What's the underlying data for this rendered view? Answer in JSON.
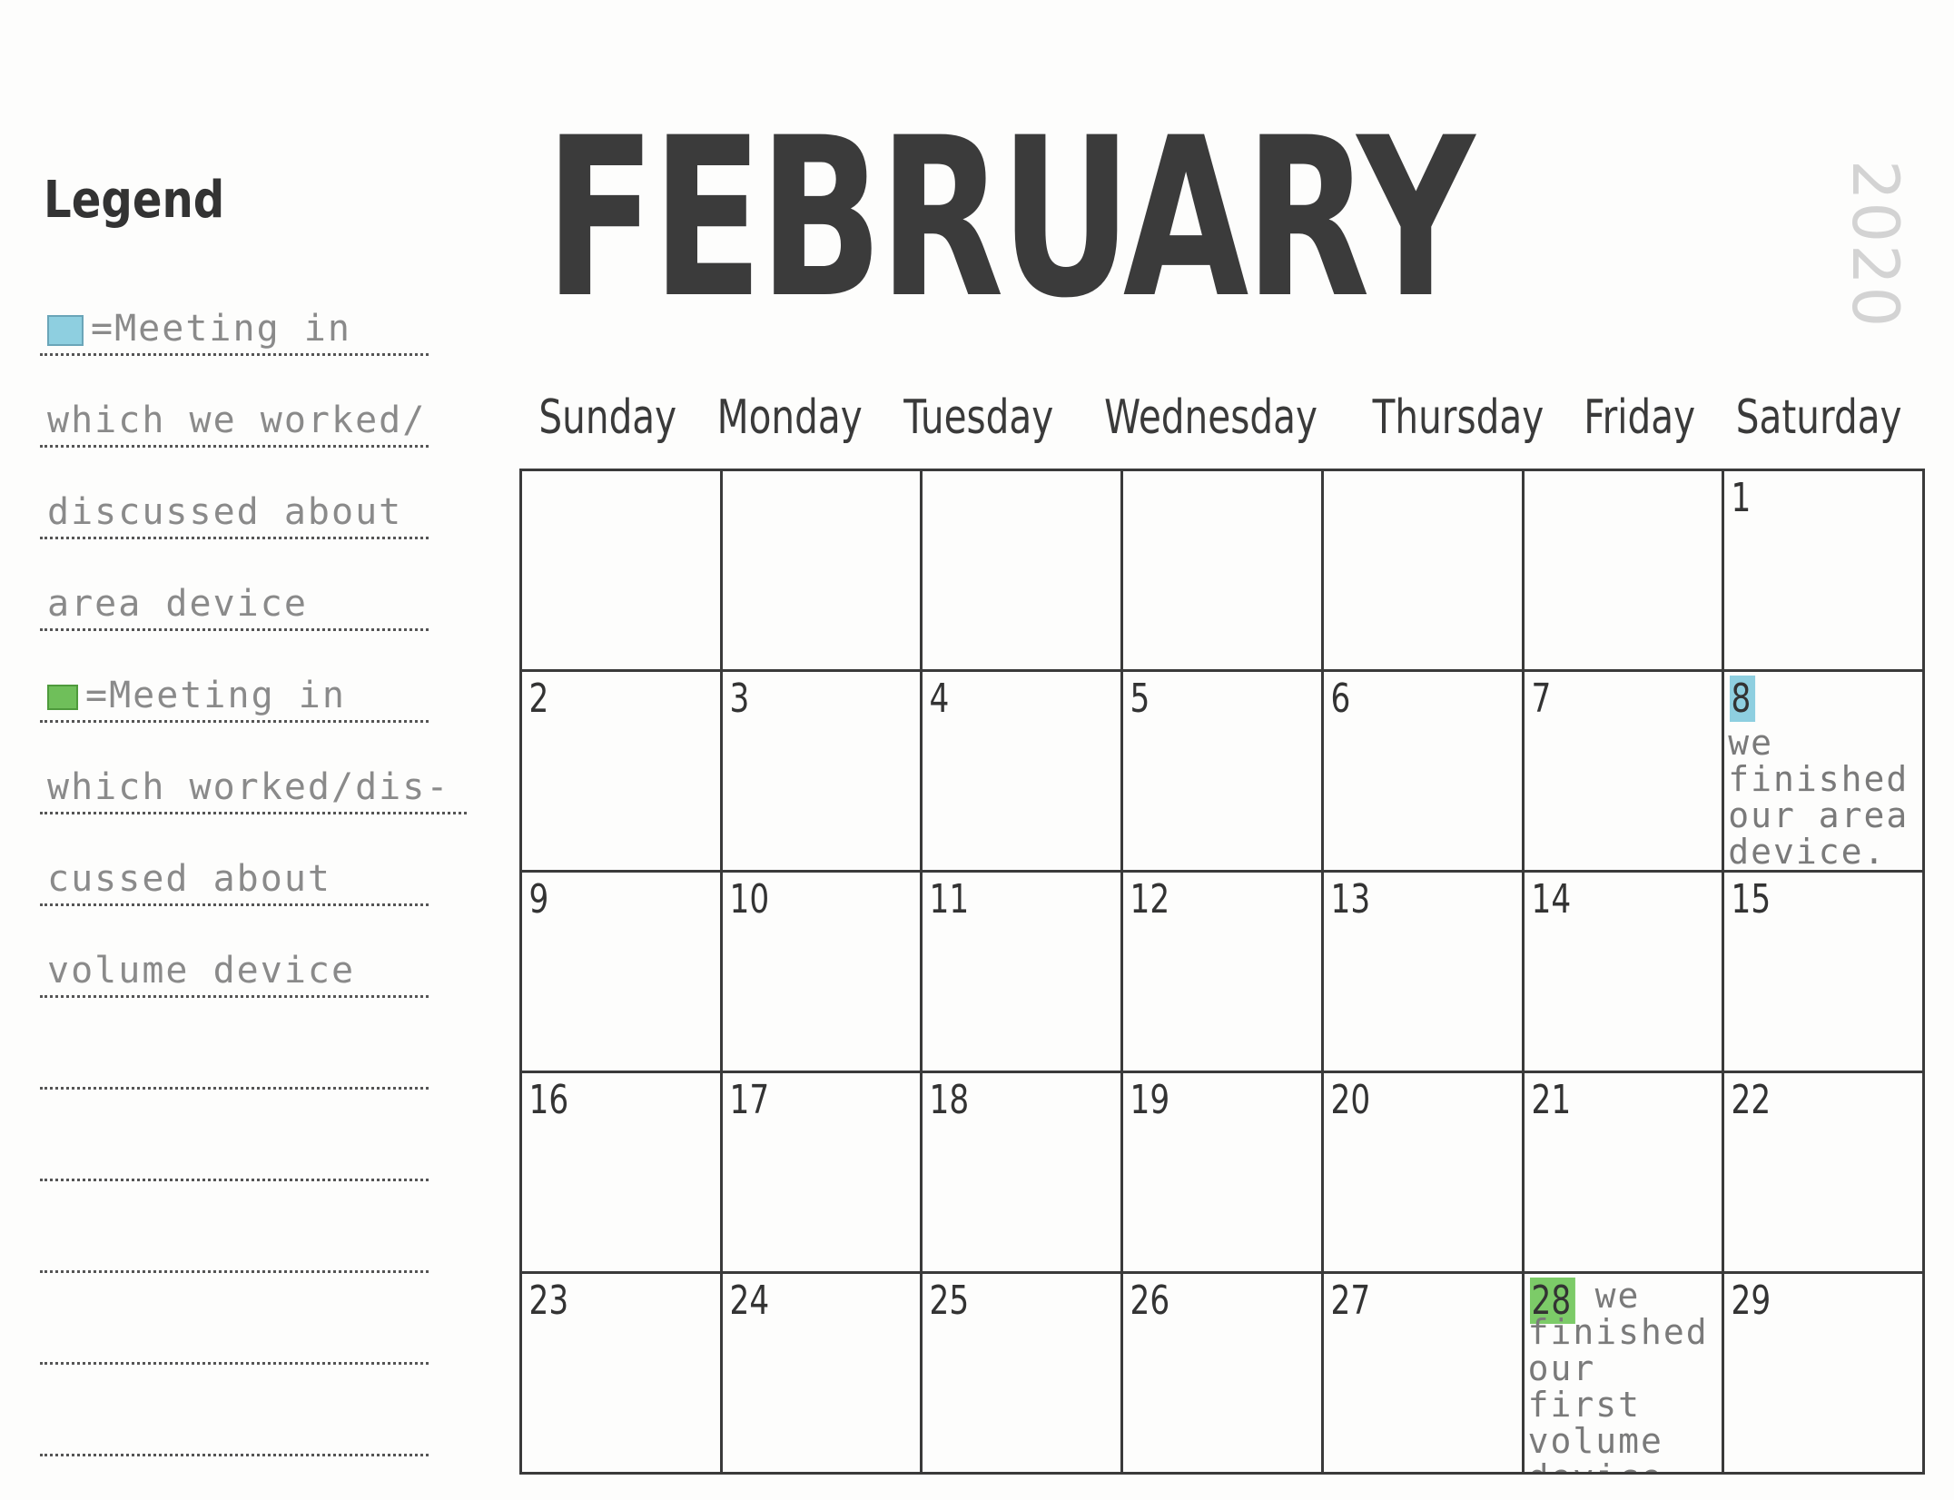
{
  "legend": {
    "title": "Legend",
    "lines": [
      {
        "text": "=Meeting in",
        "swatch": "blue"
      },
      {
        "text": "which we worked/"
      },
      {
        "text": "discussed about"
      },
      {
        "text": "area device"
      },
      {
        "text": "=Meeting in",
        "swatch": "green"
      },
      {
        "text": "which worked/dis-",
        "wide": true
      },
      {
        "text": "cussed about"
      },
      {
        "text": "volume device"
      },
      {
        "text": ""
      },
      {
        "text": ""
      },
      {
        "text": ""
      },
      {
        "text": ""
      },
      {
        "text": ""
      }
    ]
  },
  "header": {
    "month": "FEBRUARY",
    "year": "2020"
  },
  "weekdays": [
    "Sunday",
    "Monday",
    "Tuesday",
    "Wednesday",
    "Thursday",
    "Friday",
    "Saturday"
  ],
  "colors": {
    "blue_highlight": "#8ecfe0",
    "green_highlight": "#7ccb68"
  },
  "weeks": [
    [
      {
        "day": ""
      },
      {
        "day": ""
      },
      {
        "day": ""
      },
      {
        "day": ""
      },
      {
        "day": ""
      },
      {
        "day": ""
      },
      {
        "day": "1"
      }
    ],
    [
      {
        "day": "2"
      },
      {
        "day": "3"
      },
      {
        "day": "4"
      },
      {
        "day": "5"
      },
      {
        "day": "6"
      },
      {
        "day": "7"
      },
      {
        "day": "8",
        "highlight": "blue",
        "note": "we finished our area device."
      }
    ],
    [
      {
        "day": "9"
      },
      {
        "day": "10"
      },
      {
        "day": "11"
      },
      {
        "day": "12"
      },
      {
        "day": "13"
      },
      {
        "day": "14"
      },
      {
        "day": "15"
      }
    ],
    [
      {
        "day": "16"
      },
      {
        "day": "17"
      },
      {
        "day": "18"
      },
      {
        "day": "19"
      },
      {
        "day": "20"
      },
      {
        "day": "21"
      },
      {
        "day": "22"
      }
    ],
    [
      {
        "day": "23"
      },
      {
        "day": "24"
      },
      {
        "day": "25"
      },
      {
        "day": "26"
      },
      {
        "day": "27"
      },
      {
        "day": "28",
        "highlight": "green",
        "note": "we finished our first volume device",
        "note_inline": true
      },
      {
        "day": "29"
      }
    ]
  ]
}
